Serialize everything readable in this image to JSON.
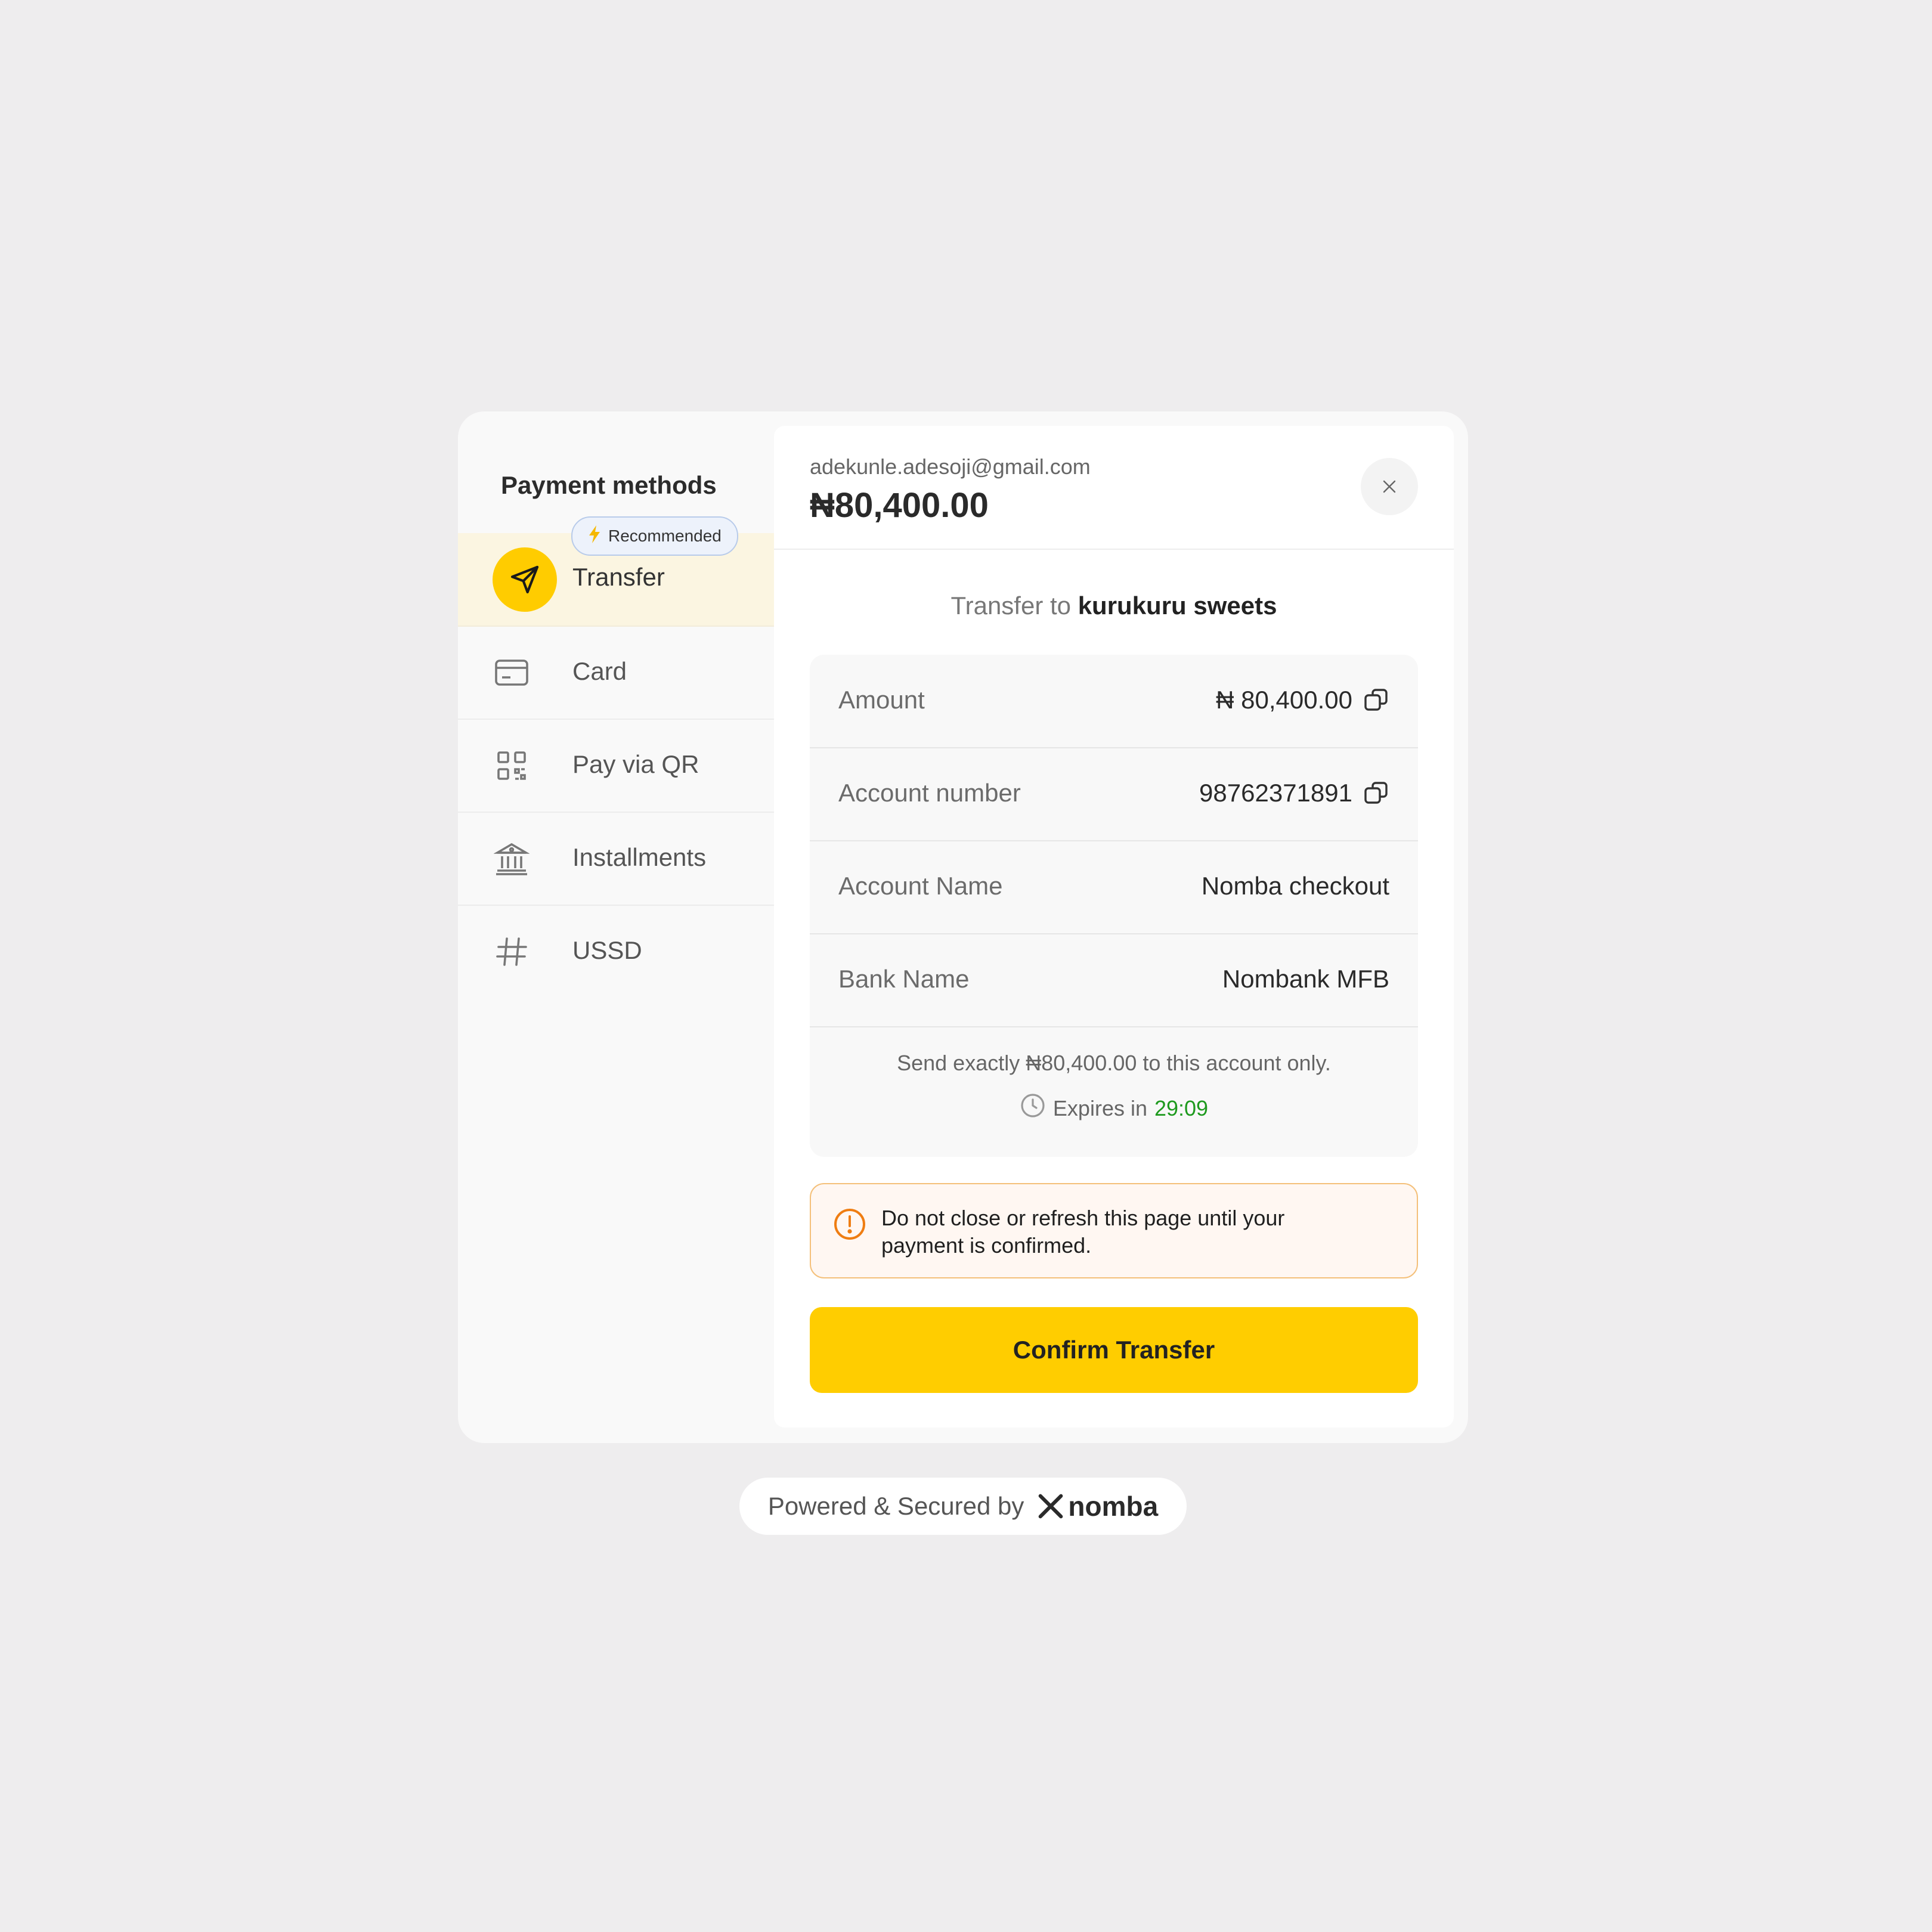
{
  "sidebar": {
    "title": "Payment methods",
    "badge": "Recommended",
    "items": [
      {
        "label": "Transfer",
        "icon": "send-icon"
      },
      {
        "label": "Card",
        "icon": "card-icon"
      },
      {
        "label": "Pay via QR",
        "icon": "qr-icon"
      },
      {
        "label": "Installments",
        "icon": "bank-icon"
      },
      {
        "label": "USSD",
        "icon": "hash-icon"
      }
    ]
  },
  "header": {
    "email": "adekunle.adesoji@gmail.com",
    "amount": "₦80,400.00"
  },
  "transfer": {
    "prefix": "Transfer to",
    "merchant": "kurukuru sweets"
  },
  "details": {
    "rows": [
      {
        "key": "Amount",
        "value": "₦ 80,400.00"
      },
      {
        "key": "Account number",
        "value": "98762371891"
      },
      {
        "key": "Account Name",
        "value": "Nomba checkout"
      },
      {
        "key": "Bank Name",
        "value": "Nombank MFB"
      }
    ],
    "note": "Send exactly ₦80,400.00 to this account only.",
    "expires_label": "Expires in",
    "timer": "29:09"
  },
  "warning": {
    "text": "Do not close or refresh this page until your payment is confirmed."
  },
  "confirm_label": "Confirm Transfer",
  "footer": {
    "text": "Powered & Secured by",
    "brand": "nomba"
  },
  "colors": {
    "accent": "#ffcd00",
    "background": "#eeedee",
    "timer": "#1e9a1e",
    "warning_border": "#f4c07a"
  }
}
